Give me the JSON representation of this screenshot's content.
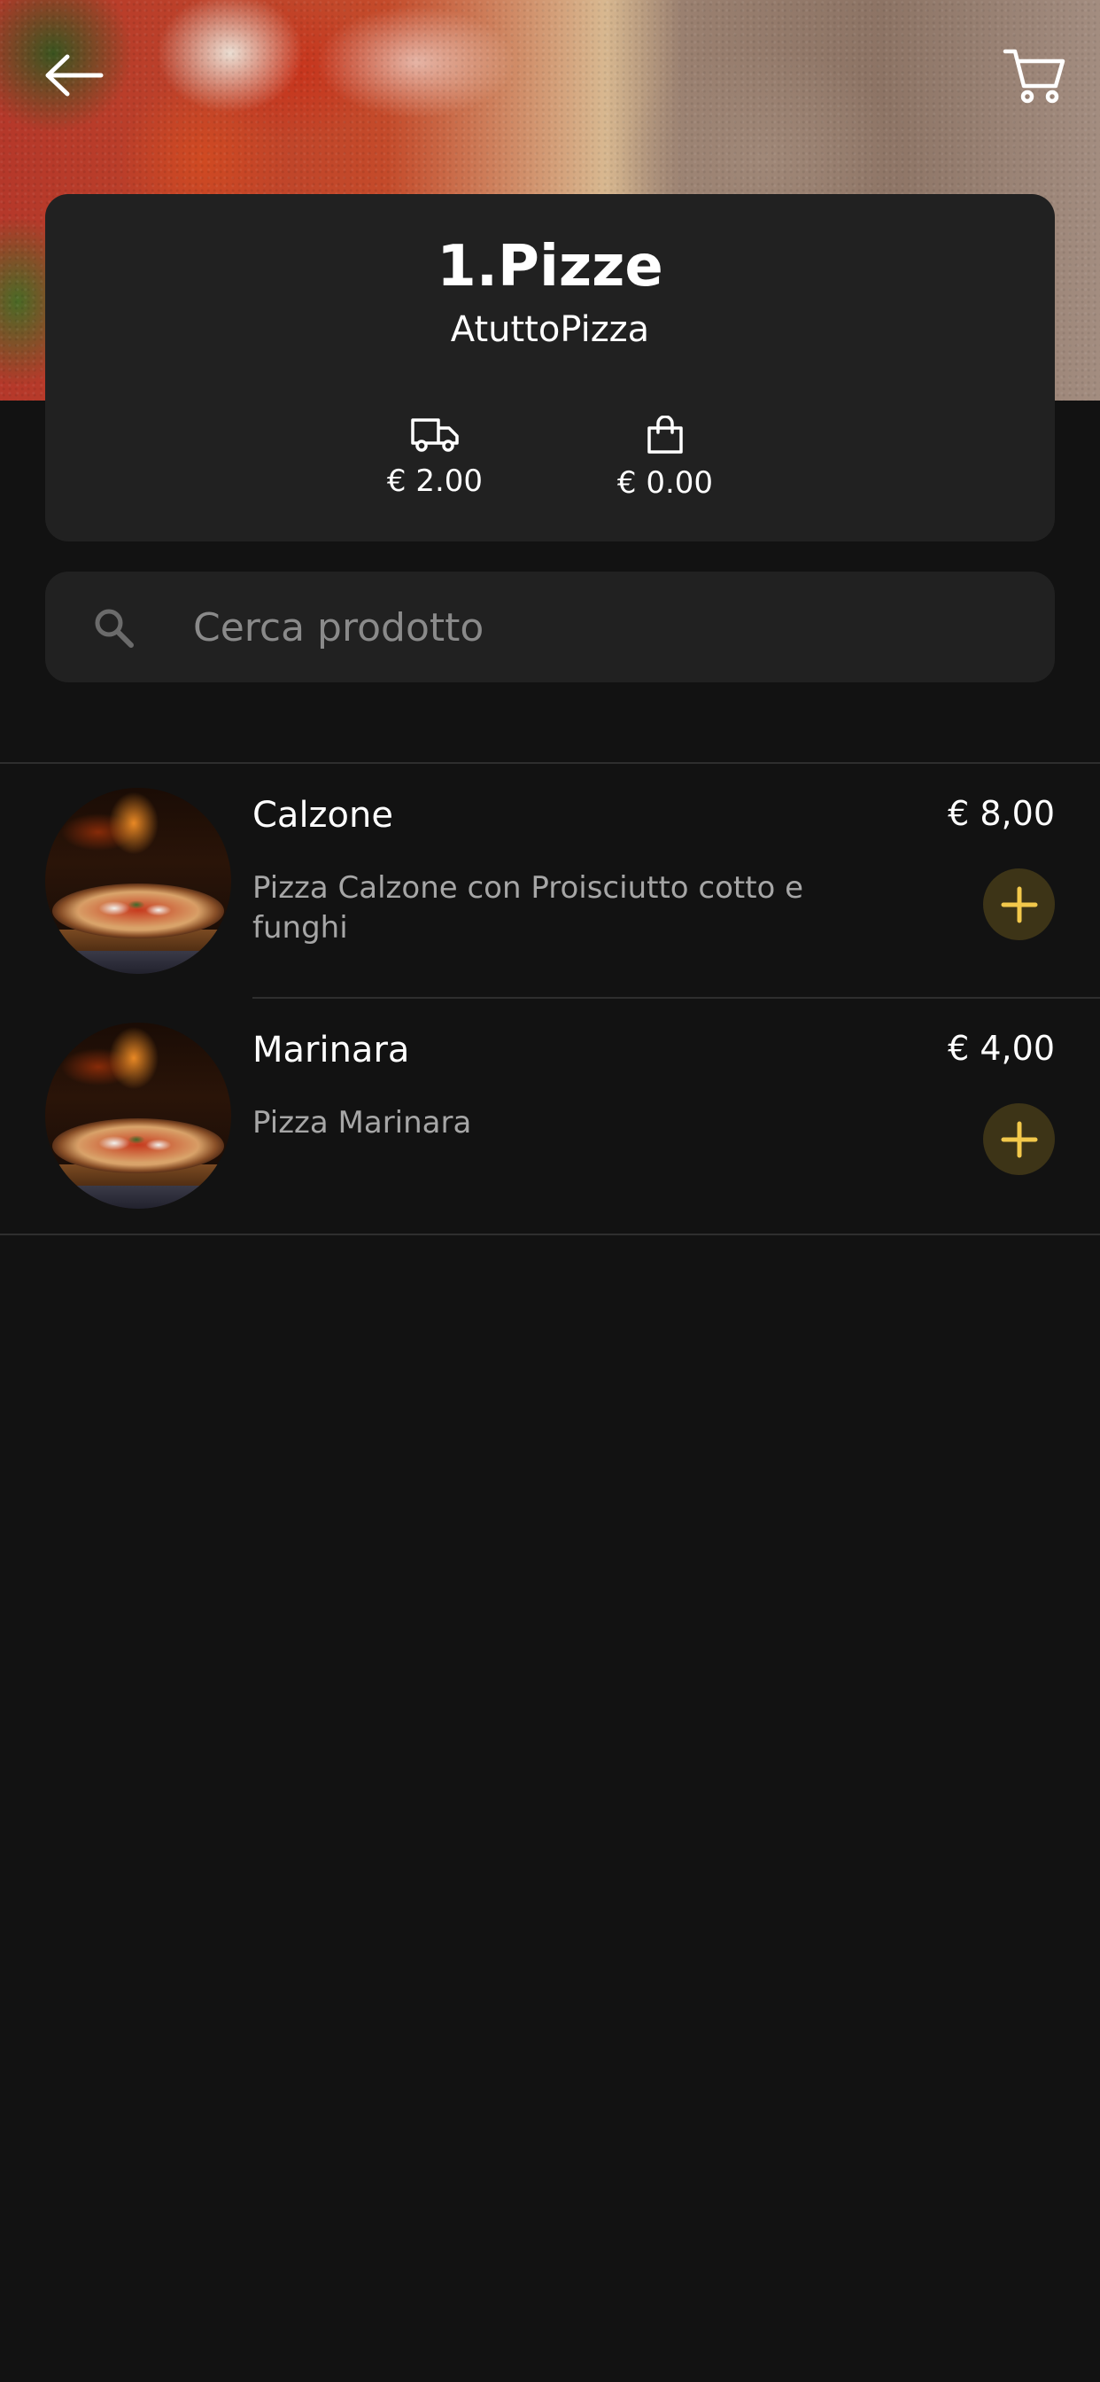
{
  "header": {
    "back_icon": "arrow-left-icon",
    "cart_icon": "shopping-cart-icon"
  },
  "store": {
    "category_title": "1.Pizze",
    "restaurant_name": "AtuttoPizza",
    "delivery_icon": "truck-icon",
    "delivery_fee": "€ 2.00",
    "minimum_icon": "shopping-bag-icon",
    "minimum_order": "€ 0.00"
  },
  "search": {
    "placeholder": "Cerca prodotto",
    "value": ""
  },
  "products": [
    {
      "name": "Calzone",
      "description": "Pizza Calzone con Proisciutto cotto e funghi",
      "price": "€ 8,00"
    },
    {
      "name": "Marinara",
      "description": "Pizza Marinara",
      "price": "€ 4,00"
    }
  ],
  "colors": {
    "background": "#121212",
    "card": "#212121",
    "accent": "#f2c84b",
    "accent_bg": "#3d3417",
    "text_primary": "#ffffff",
    "text_secondary": "#a6a6a6"
  }
}
